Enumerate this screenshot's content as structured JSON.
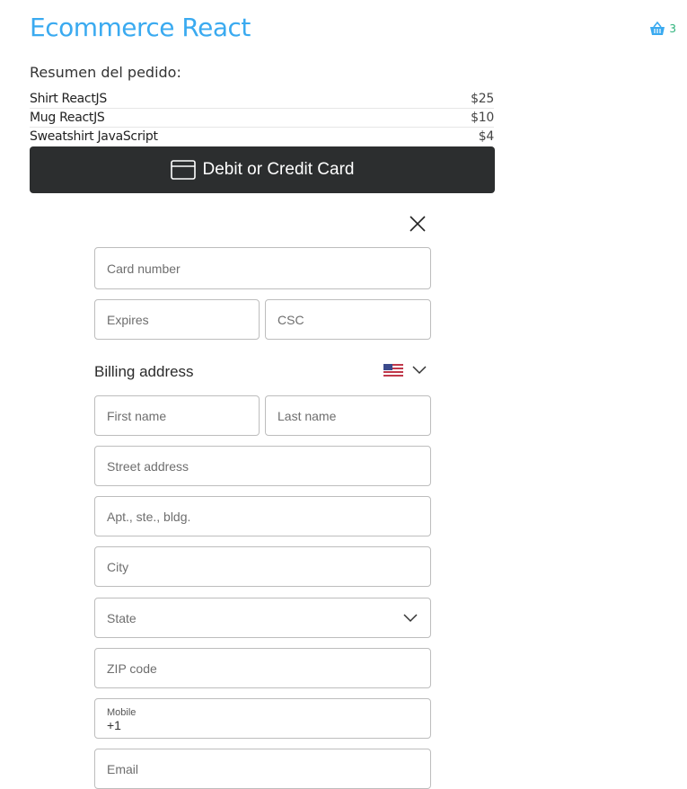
{
  "header": {
    "brand": "Ecommerce React",
    "cart_icon": "basket-icon",
    "cart_count": "3",
    "brand_color": "#3aaaf0",
    "cart_count_color": "#2bb27a"
  },
  "order": {
    "title": "Resumen del pedido:",
    "items": [
      {
        "name": "Shirt ReactJS",
        "price": "$25"
      },
      {
        "name": "Mug ReactJS",
        "price": "$10"
      },
      {
        "name": "Sweatshirt JavaScript",
        "price": "$4"
      }
    ]
  },
  "payment": {
    "button_label": "Debit or Credit Card",
    "button_icon": "credit-card-icon",
    "button_color": "#2c2e2f",
    "close_icon": "close-icon"
  },
  "form": {
    "card_number": "Card number",
    "expires": "Expires",
    "csc": "CSC",
    "billing_label": "Billing address",
    "country_icon": "us-flag-icon",
    "first_name": "First name",
    "last_name": "Last name",
    "street": "Street address",
    "apt": "Apt., ste., bldg.",
    "city": "City",
    "state": "State",
    "zip": "ZIP code",
    "mobile_label": "Mobile",
    "mobile_value": "+1",
    "email": "Email"
  }
}
